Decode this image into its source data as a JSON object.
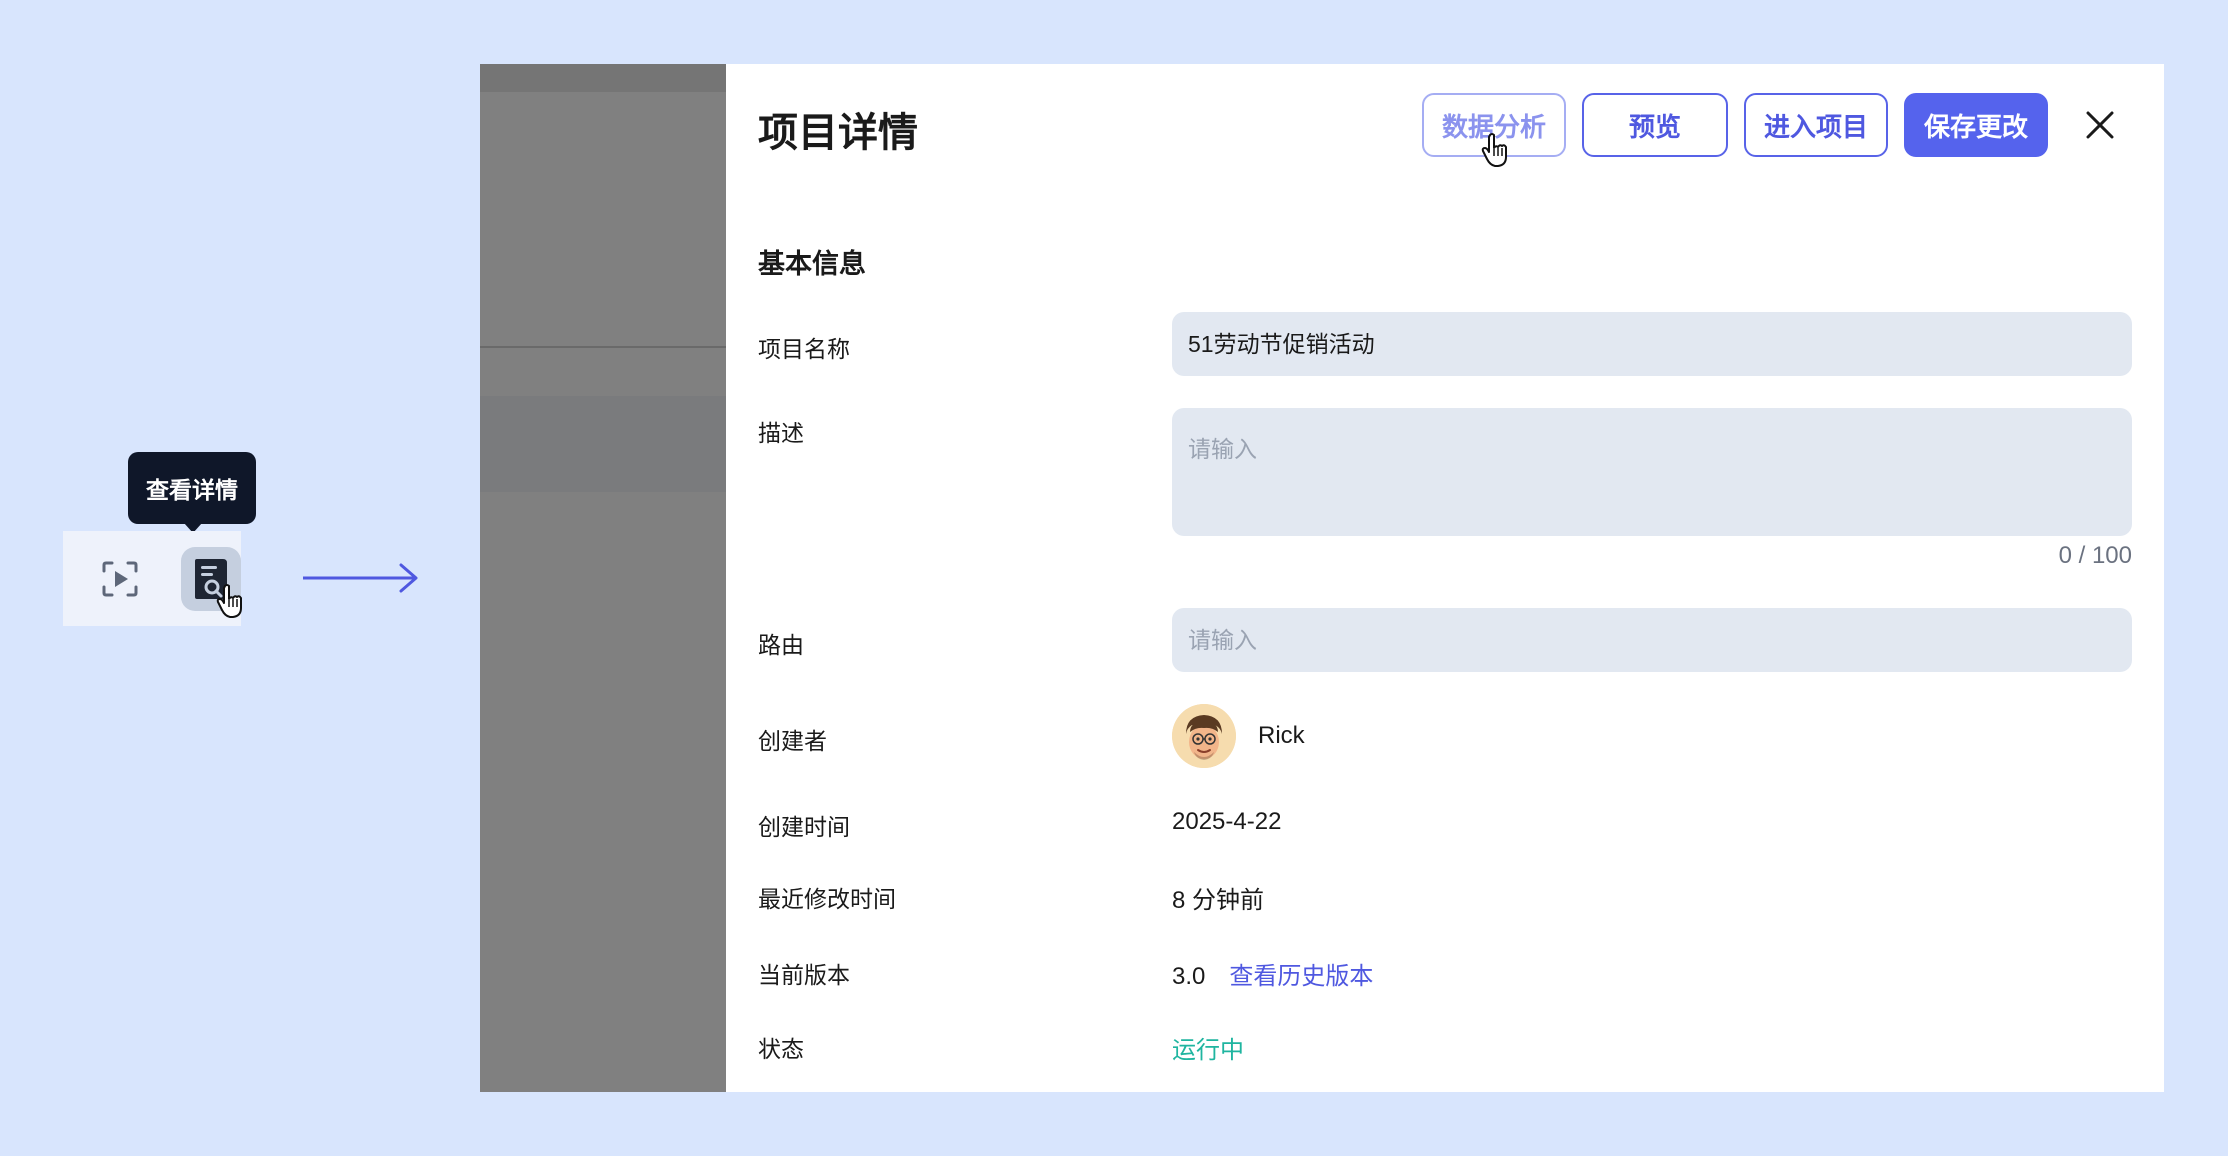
{
  "tooltip": {
    "text": "查看详情"
  },
  "toolbar": {
    "icons": [
      "screen-record-icon",
      "document-search-icon"
    ]
  },
  "drawer": {
    "title": "项目详情",
    "actions": {
      "analytics_label": "数据分析",
      "preview_label": "预览",
      "enter_label": "进入项目",
      "save_label": "保存更改"
    },
    "section_title": "基本信息",
    "fields": {
      "name_label": "项目名称",
      "name_value": "51劳动节促销活动",
      "desc_label": "描述",
      "desc_placeholder": "请输入",
      "desc_counter": "0 / 100",
      "route_label": "路由",
      "route_placeholder": "请输入",
      "creator_label": "创建者",
      "creator_name": "Rick",
      "created_label": "创建时间",
      "created_value": "2025-4-22",
      "modified_label": "最近修改时间",
      "modified_value": "8 分钟前",
      "version_label": "当前版本",
      "version_value": "3.0",
      "version_link": "查看历史版本",
      "status_label": "状态",
      "status_value": "运行中"
    }
  },
  "colors": {
    "accent": "#5563ed",
    "status_running": "#1fb5a0",
    "background": "#d8e5fd"
  }
}
